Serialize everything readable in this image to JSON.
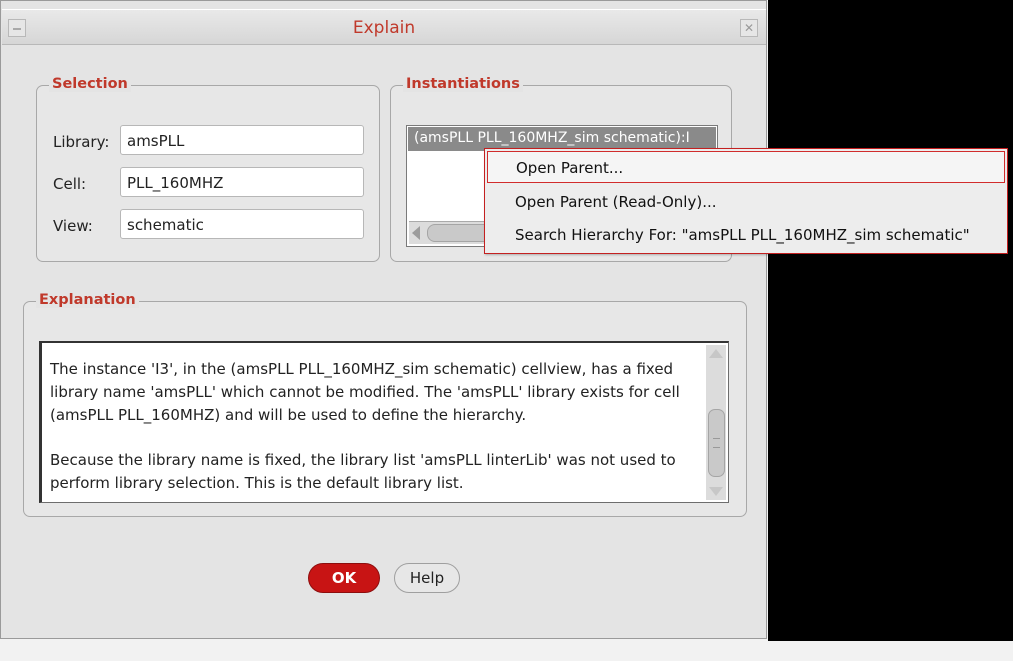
{
  "window": {
    "title": "Explain",
    "close_glyph": "✕"
  },
  "selection": {
    "legend": "Selection",
    "library_label": "Library:",
    "library_value": "amsPLL",
    "cell_label": "Cell:",
    "cell_value": "PLL_160MHZ",
    "view_label": "View:",
    "view_value": "schematic"
  },
  "instantiations": {
    "legend": "Instantiations",
    "items": [
      "(amsPLL PLL_160MHZ_sim schematic):I"
    ]
  },
  "context_menu": {
    "items": [
      "Open Parent...",
      "Open Parent (Read-Only)...",
      "Search Hierarchy For: \"amsPLL PLL_160MHZ_sim schematic\""
    ]
  },
  "explanation": {
    "legend": "Explanation",
    "paragraph1": "The instance 'I3', in the (amsPLL PLL_160MHZ_sim schematic) cellview, has a fixed library name 'amsPLL' which cannot be modified. The 'amsPLL' library exists for cell (amsPLL PLL_160MHZ) and will be used to define the hierarchy.",
    "paragraph2": "Because the library name is fixed, the library list 'amsPLL linterLib' was not used to perform library selection. This is the default library list."
  },
  "buttons": {
    "ok": "OK",
    "help": "Help"
  },
  "colors": {
    "accent_red": "#c0392b",
    "ok_button": "#c81414"
  }
}
